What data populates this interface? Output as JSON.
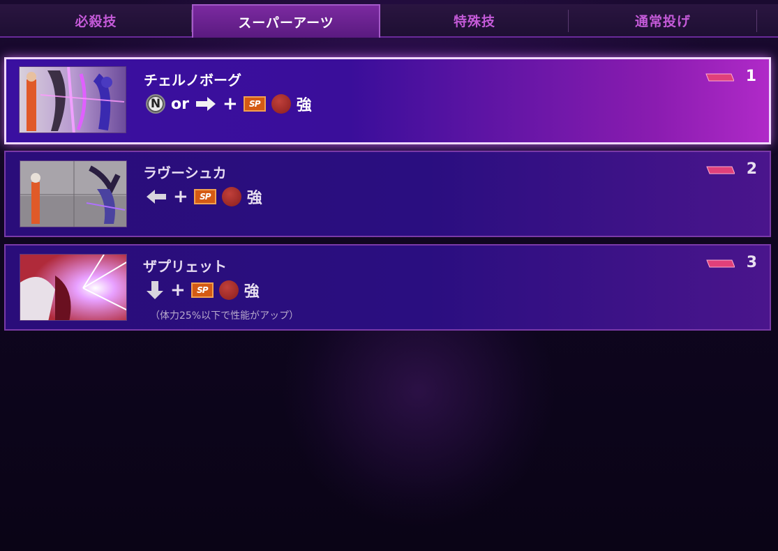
{
  "tabs": [
    {
      "label": "必殺技",
      "active": false
    },
    {
      "label": "スーパーアーツ",
      "active": true
    },
    {
      "label": "特殊技",
      "active": false
    },
    {
      "label": "通常投げ",
      "active": false
    }
  ],
  "moves": [
    {
      "name": "チェルノボーグ",
      "input": {
        "neutral": "N",
        "or": "or",
        "direction": "→",
        "plus": "+",
        "sp": "SP",
        "strength": "強"
      },
      "level": "1",
      "selected": true,
      "icons": [
        "neutral-icon",
        "arrow-right-icon",
        "sp-icon",
        "punch-button-icon"
      ]
    },
    {
      "name": "ラヴーシュカ",
      "input": {
        "direction": "←",
        "plus": "+",
        "sp": "SP",
        "strength": "強"
      },
      "level": "2",
      "selected": false,
      "icons": [
        "arrow-left-icon",
        "sp-icon",
        "punch-button-icon"
      ]
    },
    {
      "name": "ザプリェット",
      "input": {
        "direction": "↓",
        "plus": "+",
        "sp": "SP",
        "strength": "強"
      },
      "note": "（体力25%以下で性能がアップ）",
      "level": "3",
      "selected": false,
      "icons": [
        "arrow-down-icon",
        "sp-icon",
        "punch-button-icon"
      ]
    }
  ],
  "colors": {
    "accent": "#c45ad8",
    "card_bg": "#2a0d7a",
    "selected_glow": "#b02ac8",
    "gauge": "#e0407a",
    "sp_orange": "#d45a14",
    "button_red": "#a8302c"
  }
}
